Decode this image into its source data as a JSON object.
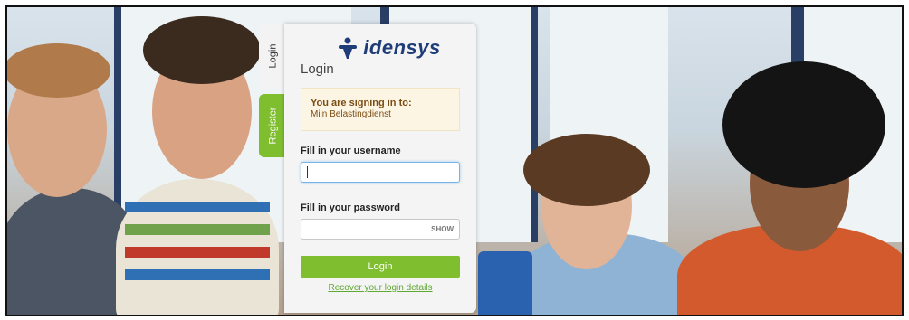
{
  "tabs": [
    {
      "label": "Login",
      "active": true
    },
    {
      "label": "Register",
      "active": false
    }
  ],
  "logo": {
    "text": "idensys",
    "icon": "idensys-person-icon",
    "color": "#1d3c78"
  },
  "card": {
    "title": "Login"
  },
  "signin": {
    "heading": "You are signing in to:",
    "target": "Mijn Belastingdienst"
  },
  "username": {
    "label": "Fill in your username",
    "value": ""
  },
  "password": {
    "label": "Fill in your password",
    "value": "",
    "show_label": "SHOW"
  },
  "login_button": {
    "label": "Login"
  },
  "recover_link": {
    "label": "Recover your login details"
  },
  "colors": {
    "accent_green": "#7fbf2f",
    "notice_bg": "#fdf5e4",
    "notice_text": "#7a4d12"
  }
}
